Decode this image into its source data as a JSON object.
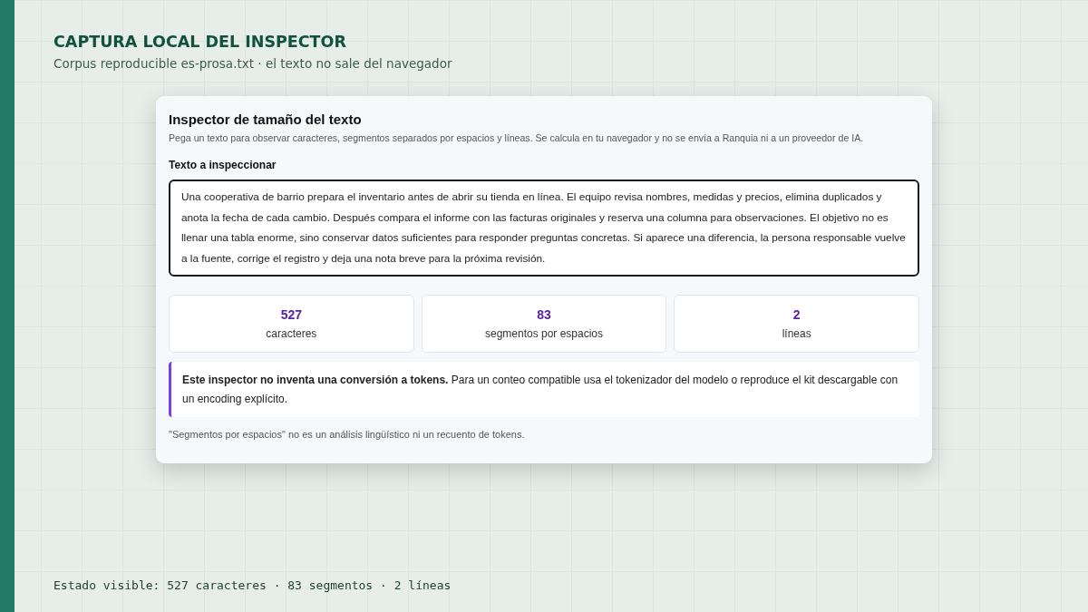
{
  "header": {
    "title": "CAPTURA LOCAL DEL INSPECTOR",
    "subtitle": "Corpus reproducible es-prosa.txt · el texto no sale del navegador"
  },
  "inspector": {
    "title": "Inspector de tamaño del texto",
    "description": "Pega un texto para observar caracteres, segmentos separados por espacios y líneas. Se calcula en tu navegador y no se envía a Ranquia ni a un proveedor de IA.",
    "field_label": "Texto a inspeccionar",
    "field_value": "Una cooperativa de barrio prepara el inventario antes de abrir su tienda en línea. El equipo revisa nombres, medidas y precios, elimina duplicados y anota la fecha de cada cambio. Después compara el informe con las facturas originales y reserva una columna para observaciones. El objetivo no es llenar una tabla enorme, sino conservar datos suficientes para responder preguntas concretas. Si aparece una diferencia, la persona responsable vuelve a la fuente, corrige el registro y deja una nota breve para la próxima revisión.",
    "stats": [
      {
        "value": "527",
        "label": "caracteres"
      },
      {
        "value": "83",
        "label": "segmentos por espacios"
      },
      {
        "value": "2",
        "label": "líneas"
      }
    ],
    "notice": "**Este inspector no inventa una conversión a tokens.** Para un conteo compatible usa el tokenizador del modelo o reproduce el kit descargable con un encoding explícito.",
    "footnote": "\"Segmentos por espacios\" no es un análisis lingüístico ni un recuento de tokens."
  },
  "status_line": "Estado visible: 527 caracteres · 83 segmentos · 2 líneas"
}
